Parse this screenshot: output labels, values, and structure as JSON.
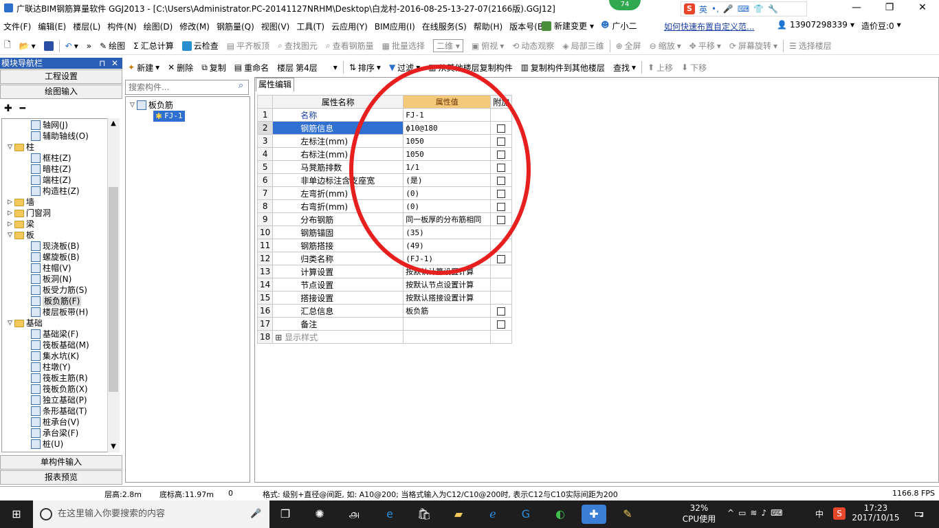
{
  "window": {
    "title": "广联达BIM钢筋算量软件 GGJ2013 - [C:\\Users\\Administrator.PC-20141127NRHM\\Desktop\\白龙村-2016-08-25-13-27-07(2166版).GGJ12]",
    "badge": "74",
    "ime_label": "英"
  },
  "menu": {
    "items": [
      "文件(F)",
      "编辑(E)",
      "楼层(L)",
      "构件(N)",
      "绘图(D)",
      "修改(M)",
      "钢筋量(Q)",
      "视图(V)",
      "工具(T)",
      "云应用(Y)",
      "BIM应用(I)",
      "在线服务(S)",
      "帮助(H)",
      "版本号(B)"
    ],
    "new_change": "新建变更",
    "assistant": "广小二",
    "help_link": "如何快速布置自定义范...",
    "phone": "13907298339",
    "coins": "造价豆:0"
  },
  "toolbar": {
    "draw": "绘图",
    "sum": "汇总计算",
    "cloud_check": "云检查",
    "flush_slab": "平齐板顶",
    "find_elem": "查找图元",
    "view_rebar": "查看钢筋量",
    "batch_select": "批量选择",
    "view_mode": "二维",
    "top_view": "俯视",
    "dynamic": "动态观察",
    "local3d": "局部三维",
    "fullscreen": "全屏",
    "zoom": "缩放",
    "pan": "平移",
    "rotate": "屏幕旋转",
    "select_floor": "选择楼层"
  },
  "toolbar2": {
    "new": "新建",
    "delete": "删除",
    "copy": "复制",
    "rename": "重命名",
    "floor_label": "楼层",
    "floor_value": "第4层",
    "sort": "排序",
    "filter": "过滤",
    "copy_from": "从其他楼层复制构件",
    "copy_to": "复制构件到其他楼层",
    "find": "查找",
    "up": "上移",
    "down": "下移"
  },
  "nav": {
    "header": "模块导航栏",
    "project_settings": "工程设置",
    "drawing_input": "绘图输入",
    "single_input": "单构件输入",
    "report_preview": "报表预览",
    "tree": [
      {
        "label": "轴网(J)",
        "level": 2,
        "type": "item"
      },
      {
        "label": "辅助轴线(O)",
        "level": 2,
        "type": "item"
      },
      {
        "label": "柱",
        "level": 1,
        "type": "folder",
        "open": true
      },
      {
        "label": "框柱(Z)",
        "level": 2,
        "type": "item"
      },
      {
        "label": "暗柱(Z)",
        "level": 2,
        "type": "item"
      },
      {
        "label": "端柱(Z)",
        "level": 2,
        "type": "item"
      },
      {
        "label": "构造柱(Z)",
        "level": 2,
        "type": "item"
      },
      {
        "label": "墙",
        "level": 1,
        "type": "folder",
        "open": false
      },
      {
        "label": "门窗洞",
        "level": 1,
        "type": "folder",
        "open": false
      },
      {
        "label": "梁",
        "level": 1,
        "type": "folder",
        "open": false
      },
      {
        "label": "板",
        "level": 1,
        "type": "folder",
        "open": true
      },
      {
        "label": "现浇板(B)",
        "level": 2,
        "type": "item"
      },
      {
        "label": "螺旋板(B)",
        "level": 2,
        "type": "item"
      },
      {
        "label": "柱帽(V)",
        "level": 2,
        "type": "item"
      },
      {
        "label": "板洞(N)",
        "level": 2,
        "type": "item"
      },
      {
        "label": "板受力筋(S)",
        "level": 2,
        "type": "item"
      },
      {
        "label": "板负筋(F)",
        "level": 2,
        "type": "item",
        "selected": true
      },
      {
        "label": "楼层板带(H)",
        "level": 2,
        "type": "item"
      },
      {
        "label": "基础",
        "level": 1,
        "type": "folder",
        "open": true
      },
      {
        "label": "基础梁(F)",
        "level": 2,
        "type": "item"
      },
      {
        "label": "筏板基础(M)",
        "level": 2,
        "type": "item"
      },
      {
        "label": "集水坑(K)",
        "level": 2,
        "type": "item"
      },
      {
        "label": "柱墩(Y)",
        "level": 2,
        "type": "item"
      },
      {
        "label": "筏板主筋(R)",
        "level": 2,
        "type": "item"
      },
      {
        "label": "筏板负筋(X)",
        "level": 2,
        "type": "item"
      },
      {
        "label": "独立基础(P)",
        "level": 2,
        "type": "item"
      },
      {
        "label": "条形基础(T)",
        "level": 2,
        "type": "item"
      },
      {
        "label": "桩承台(V)",
        "level": 2,
        "type": "item"
      },
      {
        "label": "承台梁(F)",
        "level": 2,
        "type": "item"
      },
      {
        "label": "桩(U)",
        "level": 2,
        "type": "item"
      }
    ]
  },
  "component": {
    "search_placeholder": "搜索构件...",
    "root": "板负筋",
    "child": "FJ-1"
  },
  "props": {
    "tab": "属性编辑",
    "col_name": "属性名称",
    "col_value": "属性值",
    "col_add": "附加",
    "rows": [
      {
        "n": "1",
        "name": "名称",
        "value": "FJ-1",
        "check": false,
        "blue": true
      },
      {
        "n": "2",
        "name": "钢筋信息",
        "value": "ф10@180",
        "check": true,
        "selected": true
      },
      {
        "n": "3",
        "name": "左标注(mm)",
        "value": "1050",
        "check": true
      },
      {
        "n": "4",
        "name": "右标注(mm)",
        "value": "1050",
        "check": true
      },
      {
        "n": "5",
        "name": "马凳筋排数",
        "value": "1/1",
        "check": true
      },
      {
        "n": "6",
        "name": "非单边标注含支座宽",
        "value": "(是)",
        "check": true
      },
      {
        "n": "7",
        "name": "左弯折(mm)",
        "value": "(0)",
        "check": true
      },
      {
        "n": "8",
        "name": "右弯折(mm)",
        "value": "(0)",
        "check": true
      },
      {
        "n": "9",
        "name": "分布钢筋",
        "value": "同一板厚的分布筋相同",
        "check": true
      },
      {
        "n": "10",
        "name": "钢筋锚固",
        "value": "(35)",
        "check": false
      },
      {
        "n": "11",
        "name": "钢筋搭接",
        "value": "(49)",
        "check": false
      },
      {
        "n": "12",
        "name": "归类名称",
        "value": "(FJ-1)",
        "check": true
      },
      {
        "n": "13",
        "name": "计算设置",
        "value": "按默认计算设置计算",
        "check": false
      },
      {
        "n": "14",
        "name": "节点设置",
        "value": "按默认节点设置计算",
        "check": false
      },
      {
        "n": "15",
        "name": "搭接设置",
        "value": "按默认搭接设置计算",
        "check": false
      },
      {
        "n": "16",
        "name": "汇总信息",
        "value": "板负筋",
        "check": true
      },
      {
        "n": "17",
        "name": "备注",
        "value": "",
        "check": true
      },
      {
        "n": "18",
        "name": "显示样式",
        "value": "",
        "check": false,
        "expander": true,
        "gray": true
      }
    ]
  },
  "status": {
    "floor_height": "层高:2.8m",
    "base_height": "底标高:11.97m",
    "zero": "0",
    "hint": "格式: 级别+直径@间距, 如: A10@200; 当格式输入为C12/C10@200时, 表示C12与C10实际间距为200",
    "fps": "1166.8 FPS"
  },
  "taskbar": {
    "search": "在这里输入你要搜索的内容",
    "cpu_pct": "32%",
    "cpu_label": "CPU使用",
    "lang": "中",
    "time": "17:23",
    "date": "2017/10/15",
    "notif": "2"
  }
}
